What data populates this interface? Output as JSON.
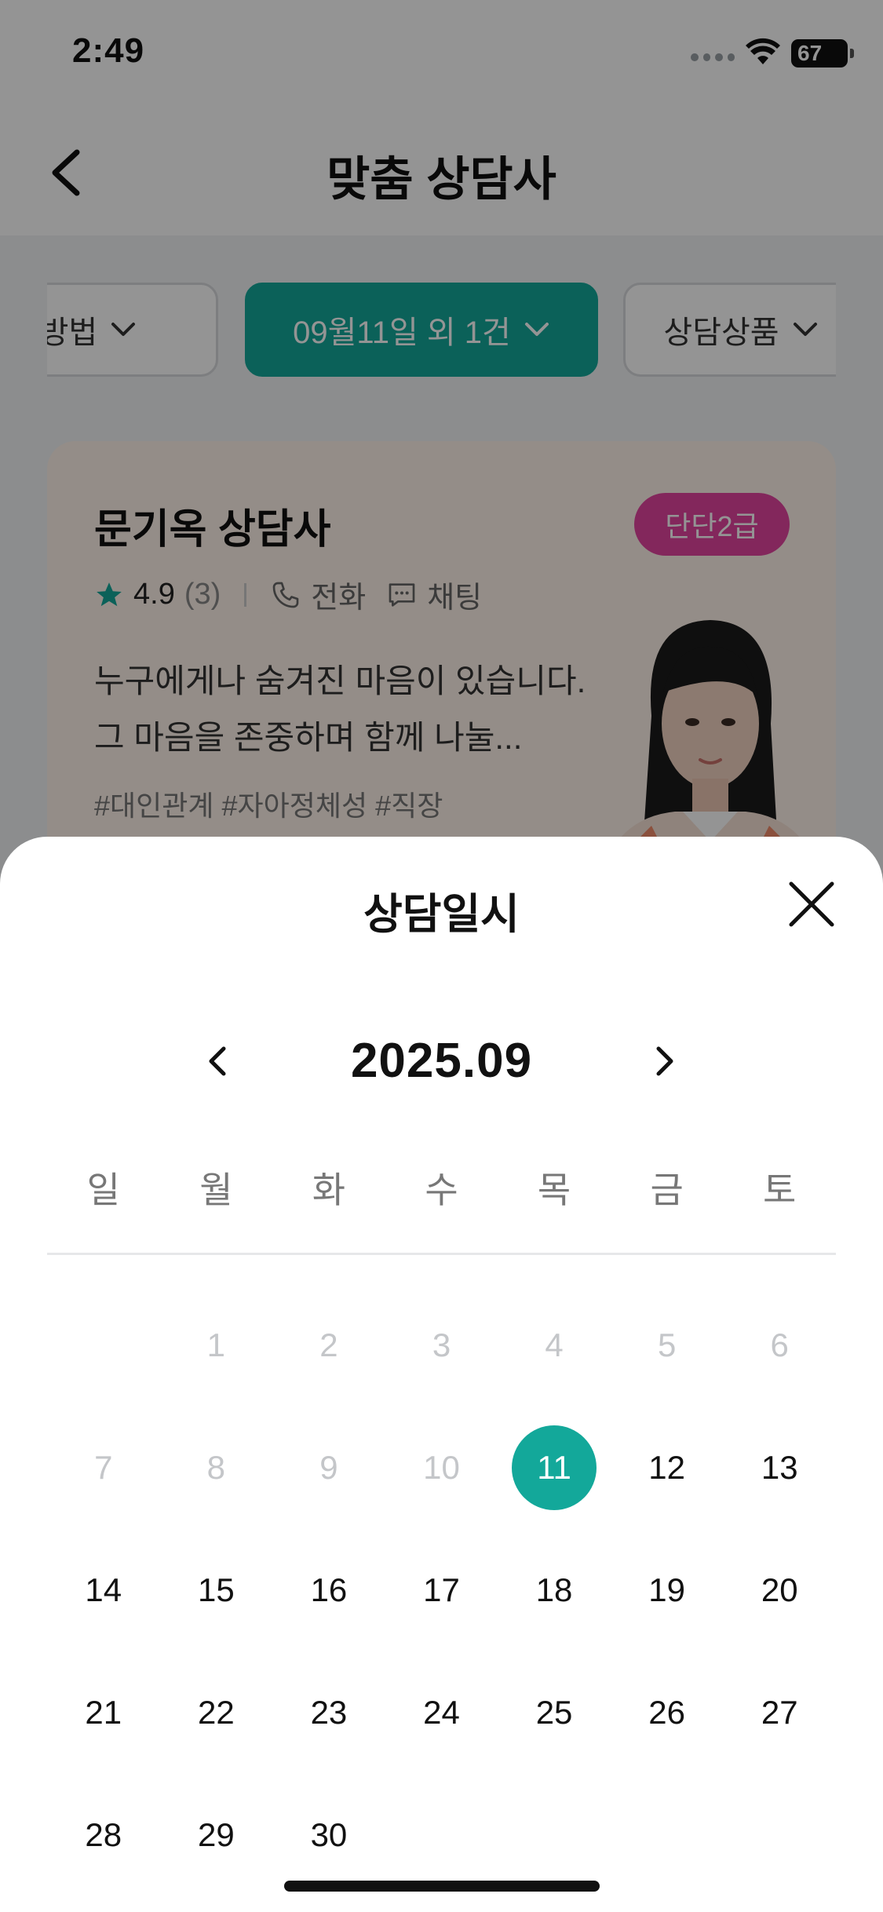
{
  "status_bar": {
    "time": "2:49",
    "battery": "67"
  },
  "nav": {
    "title": "맞춤 상담사"
  },
  "filters": {
    "method": "담방법",
    "date": "09월11일 외 1건",
    "product": "상담상품"
  },
  "counselor_card": {
    "name": "문기옥 상담사",
    "grade": "단단2급",
    "rating": "4.9",
    "review_count": "(3)",
    "phone_label": "전화",
    "chat_label": "채팅",
    "description": "누구에게나 숨겨진 마음이 있습니다. 그 마음을 존중하며 함께 나눌...",
    "hashtags": "#대인관계 #자아정체성 #직장"
  },
  "sheet": {
    "title": "상담일시",
    "month": "2025.09",
    "weekdays": [
      "일",
      "월",
      "화",
      "수",
      "목",
      "금",
      "토"
    ],
    "days": [
      {
        "label": "",
        "state": "empty"
      },
      {
        "label": "1",
        "state": "disabled"
      },
      {
        "label": "2",
        "state": "disabled"
      },
      {
        "label": "3",
        "state": "disabled"
      },
      {
        "label": "4",
        "state": "disabled"
      },
      {
        "label": "5",
        "state": "disabled"
      },
      {
        "label": "6",
        "state": "disabled"
      },
      {
        "label": "7",
        "state": "disabled"
      },
      {
        "label": "8",
        "state": "disabled"
      },
      {
        "label": "9",
        "state": "disabled"
      },
      {
        "label": "10",
        "state": "disabled"
      },
      {
        "label": "11",
        "state": "selected"
      },
      {
        "label": "12",
        "state": "enabled"
      },
      {
        "label": "13",
        "state": "enabled"
      },
      {
        "label": "14",
        "state": "enabled"
      },
      {
        "label": "15",
        "state": "enabled"
      },
      {
        "label": "16",
        "state": "enabled"
      },
      {
        "label": "17",
        "state": "enabled"
      },
      {
        "label": "18",
        "state": "enabled"
      },
      {
        "label": "19",
        "state": "enabled"
      },
      {
        "label": "20",
        "state": "enabled"
      },
      {
        "label": "21",
        "state": "enabled"
      },
      {
        "label": "22",
        "state": "enabled"
      },
      {
        "label": "23",
        "state": "enabled"
      },
      {
        "label": "24",
        "state": "enabled"
      },
      {
        "label": "25",
        "state": "enabled"
      },
      {
        "label": "26",
        "state": "enabled"
      },
      {
        "label": "27",
        "state": "enabled"
      },
      {
        "label": "28",
        "state": "enabled"
      },
      {
        "label": "29",
        "state": "enabled"
      },
      {
        "label": "30",
        "state": "enabled"
      }
    ]
  },
  "colors": {
    "accent": "#13a89a",
    "badge": "#e2449f"
  }
}
